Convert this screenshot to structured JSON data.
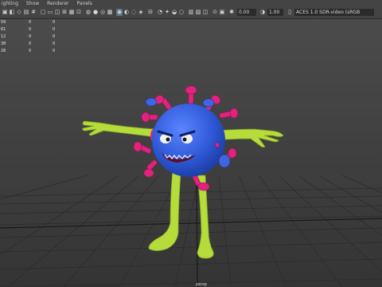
{
  "menu": [
    "ighting",
    "Show",
    "Renderer",
    "Panels"
  ],
  "toolbar": {
    "icons": [
      "camera-icon",
      "camera-attributes-icon",
      "bookmark-icon",
      "image-plane-icon",
      "grid-toggle-icon",
      "film-gate-icon",
      "resolution-gate-icon",
      "gate-mask-icon",
      "field-chart-icon",
      "safe-action-icon",
      "safe-title-icon",
      "wireframe-icon",
      "smooth-shade-icon",
      "default-material-icon",
      "textured-icon",
      "use-all-lights-icon",
      "shadows-icon",
      "screen-space-ao-icon",
      "motion-blur-icon",
      "isolate-select-icon",
      "xray-icon",
      "xray-joints-icon",
      "backface-culling-icon",
      "exposure-icon"
    ],
    "exposure_value": "0.00",
    "gamma_value": "1.00",
    "color_space": "ACES 1.0 SDR-video (sRGB"
  },
  "hud": {
    "rows": [
      {
        "label": "59",
        "a": "0",
        "b": "0"
      },
      {
        "label": "61",
        "a": "0",
        "b": "0"
      },
      {
        "label": "12",
        "a": "0",
        "b": "0"
      },
      {
        "label": "38",
        "a": "0",
        "b": "0"
      },
      {
        "label": "26",
        "a": "0",
        "b": "0"
      }
    ]
  },
  "viewport": {
    "background_top": "#4a4a4a",
    "background_bottom": "#343434",
    "grid_color": "#2a2a2a",
    "body_color": "#2f59d8",
    "spike_color": "#e0237d",
    "limb_color": "#b5dc3a"
  },
  "bottom_label": "persp"
}
